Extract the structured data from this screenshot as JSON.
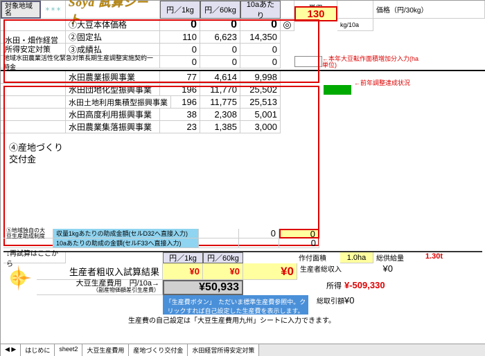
{
  "header": {
    "target_area": "対象地域名",
    "stars": "＊＊＊",
    "title": "Soya 試算シート",
    "cols": [
      "円／1kg",
      "円／60kg",
      "10aあたり"
    ],
    "unit_yield_lbl": "単収",
    "unit_yield_val": "130",
    "unit_yield_unit": "kg/10a",
    "price_lbl": "価格（円/30kg）"
  },
  "main": {
    "r1": {
      "lbl": "①大豆本体価格",
      "v": [
        "0",
        "0",
        "0"
      ],
      "mark": "◎"
    },
    "side_lbl": "水田・畑作経営所得安定対策",
    "r2": {
      "lbl": "②固定払",
      "v": [
        "110",
        "6,623",
        "14,350"
      ]
    },
    "r3": {
      "lbl": "③成績払",
      "v": [
        "0",
        "0",
        "0"
      ]
    },
    "r4": {
      "lbl": "地域水田農業活性化緊急対策長期生産調整実施契約一時金",
      "v": [
        "0",
        "0",
        "0"
      ]
    },
    "note1": "←本年大豆転作面積増加分入力(ha単位)",
    "note2": "←前年調整達成状況",
    "r5": {
      "lbl": "水田農業振興事業",
      "v": [
        "77",
        "4,614",
        "9,998"
      ]
    },
    "r6": {
      "lbl": "水田団地化型振興事業",
      "v": [
        "196",
        "11,770",
        "25,502"
      ]
    },
    "r7": {
      "lbl": "水田土地利用集積型振興事業",
      "v": [
        "196",
        "11,775",
        "25,513"
      ]
    },
    "r8": {
      "lbl": "水田高度利用振興事業",
      "v": [
        "38",
        "2,308",
        "5,001"
      ]
    },
    "r9": {
      "lbl": "水田農業集落振興事業",
      "v": [
        "23",
        "1,385",
        "3,000"
      ]
    },
    "section4": "④産地づくり交付金",
    "r10a": {
      "side": "⑤地域独自の大豆生産助成制度",
      "lbl1": "収量1kgあたりの助成金額(セルD32へ直接入力)",
      "lbl2": "10aあたりの助成の金額(セルF33へ直接入力)",
      "v1": "0",
      "v2": "0",
      "v3": "0"
    }
  },
  "bottom": {
    "recalc": "↓再試算はここから",
    "cols": [
      "円／1kg",
      "円／60kg"
    ],
    "gross_lbl": "生産者粗収入試算結果",
    "gross_v": [
      "¥0",
      "¥0",
      "¥0"
    ],
    "cost_lbl": "大豆生産費用　円/10a→",
    "cost_sub": "（副産物価額差引生産費）",
    "cost_v": "¥50,933",
    "blue_msg": "「生産費ボタン」　ただいま標準生産費参照中。クリックすれば自己設定した生産費を表示します。",
    "self_note": "生産費の自己設定は「大豆生産費用九州」シートに入力できます。",
    "area_lbl": "作付面積",
    "area_v": "1.0ha",
    "total_yield_lbl": "総供給量",
    "total_yield_v": "1.30t",
    "total_rev_lbl": "生産者総収入",
    "total_rev_v": "¥0",
    "income_lbl": "所得",
    "income_v": "¥-509,330",
    "deduct_lbl": "総取引額",
    "deduct_v": "¥0"
  },
  "tabs": {
    "nav": "◀ ▶",
    "items": [
      "はじめに",
      "sheet2",
      "大豆生産費用",
      "産地づくり交付金",
      "水田経営所得安定対策"
    ]
  }
}
